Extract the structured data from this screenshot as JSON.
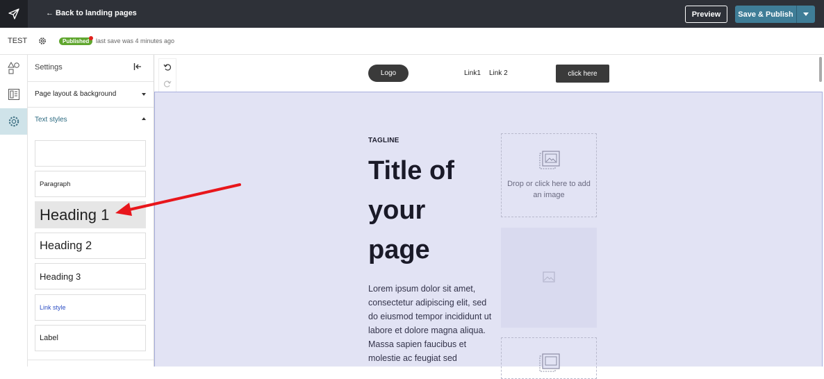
{
  "topbar": {
    "back_label": "← Back to landing pages",
    "preview_label": "Preview",
    "publish_label": "Save & Publish"
  },
  "subbar": {
    "page_name": "TEST",
    "status_badge": "Published",
    "save_status": "last save was 4 minutes ago"
  },
  "panel": {
    "title": "Settings",
    "sections": {
      "layout": "Page layout & background",
      "text_styles": "Text styles"
    },
    "text_styles": {
      "empty": "",
      "paragraph": "Paragraph",
      "heading1": "Heading 1",
      "heading2": "Heading 2",
      "heading3": "Heading 3",
      "link": "Link style",
      "label": "Label"
    }
  },
  "canvas": {
    "logo_label": "Logo",
    "links": [
      "Link1",
      "Link 2"
    ],
    "cta_label": "click here",
    "tagline": "TAGLINE",
    "title": "Title of your page",
    "body": "Lorem ipsum dolor sit amet, consectetur adipiscing elit, sed do eiusmod tempor incididunt ut labore et dolore magna aliqua. Massa sapien faucibus et molestie ac feugiat sed",
    "image_drop_text": "Drop or click here to add an image"
  },
  "colors": {
    "topbar": "#2e3138",
    "publish": "#3f7d97",
    "badge": "#5fa62e",
    "hero_bg": "#e2e3f4",
    "annotation_arrow": "#e8161b"
  }
}
